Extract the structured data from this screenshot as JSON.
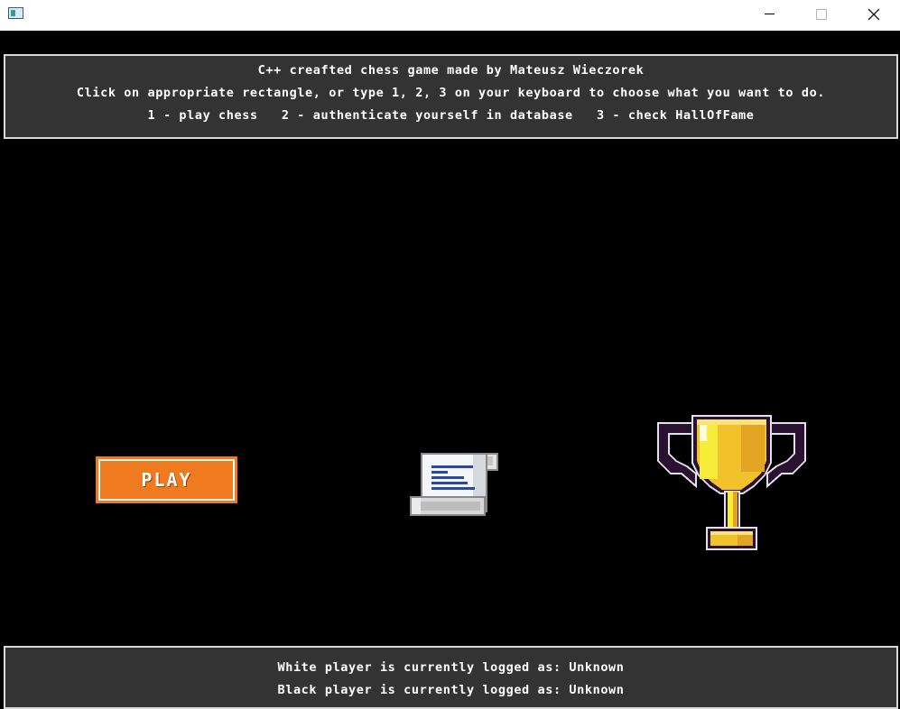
{
  "header": {
    "line1": "C++ creafted chess game made by Mateusz Wieczorek",
    "line2": "Click on appropriate rectangle, or type 1, 2, 3 on your keyboard to choose what you want to do.",
    "line3": "1 - play chess   2 - authenticate yourself in database   3 - check HallOfFame"
  },
  "menu": {
    "play_label": "PLAY",
    "auth_icon": "scroll-document-icon",
    "halloffame_icon": "trophy-icon"
  },
  "status": {
    "white_line": "White player is currently logged as: Unknown",
    "black_line": "Black player is currently logged as: Unknown"
  },
  "colors": {
    "background": "#000000",
    "panel": "#333333",
    "panel_border": "#d9d9d9",
    "play_button": "#f07a1f",
    "trophy_gold": "#f2c22a",
    "scroll_text": "#2b4a9a"
  }
}
